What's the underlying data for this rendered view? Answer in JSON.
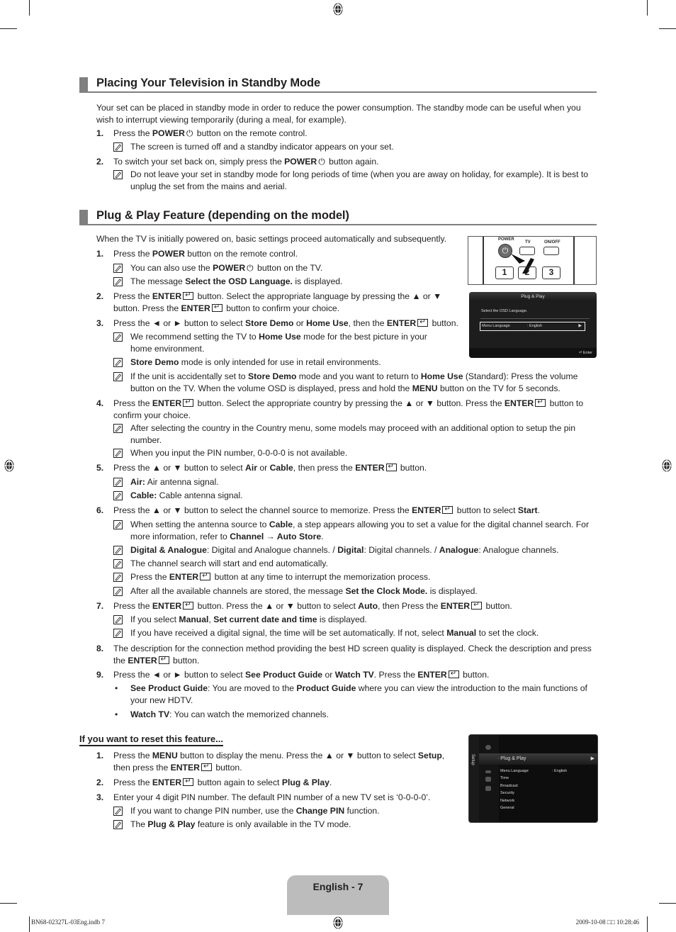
{
  "sections": {
    "standby": {
      "title": "Placing Your Television in Standby Mode",
      "intro": "Your set can be placed in standby mode in order to reduce the power consumption. The standby mode can be useful when you wish to interrupt viewing temporarily (during a meal, for example).",
      "steps": [
        {
          "num": "1.",
          "pre": "Press the ",
          "bold": "POWER",
          "post": " button on the remote control.",
          "notes": [
            "The screen is turned off and a standby indicator appears on your set."
          ]
        },
        {
          "num": "2.",
          "pre": "To switch your set back on, simply press the ",
          "bold": "POWER",
          "post": " button again.",
          "notes": [
            "Do not leave your set in standby mode for long periods of time (when you are away on holiday, for example). It is best to unplug the set from the mains and aerial."
          ]
        }
      ]
    },
    "plugplay": {
      "title": "Plug & Play Feature (depending on the model)",
      "intro": "When the TV is initially powered on, basic settings proceed automatically and subsequently.",
      "s1": {
        "num": "1.",
        "a": "Press the ",
        "b": "POWER",
        "c": " button on the remote control.",
        "n1a": "You can also use the ",
        "n1b": "POWER",
        "n1c": " button on the TV.",
        "n2a": "The message ",
        "n2b": "Select the OSD Language.",
        "n2c": " is displayed."
      },
      "s2": {
        "num": "2.",
        "a": "Press the ",
        "b": "ENTER",
        "c": " button. Select the appropriate language by pressing the ▲ or ▼ button. Press the ",
        "d": "ENTER",
        "e": " button to confirm your choice."
      },
      "s3": {
        "num": "3.",
        "a": "Press the ◄ or ► button to select ",
        "b": "Store Demo",
        "c": " or ",
        "d": "Home Use",
        "e": ", then the ",
        "f": "ENTER",
        "g": " button.",
        "n1a": "We recommend setting the TV to ",
        "n1b": "Home Use",
        "n1c": " mode for the best picture in your home environment.",
        "n2b": "Store Demo",
        "n2c": " mode is only intended for use in retail environments.",
        "n3a": "If the unit is accidentally set to ",
        "n3b": "Store Demo",
        "n3c": " mode and you want to return to ",
        "n3d": "Home Use",
        "n3e": " (Standard): Press the volume button on the TV. When the volume OSD is displayed, press and hold the ",
        "n3f": "MENU",
        "n3g": " button on the TV for 5 seconds."
      },
      "s4": {
        "num": "4.",
        "a": "Press the ",
        "b": "ENTER",
        "c": " button. Select the appropriate country by pressing the ▲ or ▼ button. Press the ",
        "d": "ENTER",
        "e": " button to confirm your choice.",
        "n1": "After selecting the country in the Country menu, some models may proceed with an additional option to setup the pin number.",
        "n2": "When you input the PIN number, 0-0-0-0 is not available."
      },
      "s5": {
        "num": "5.",
        "a": "Press the ▲ or ▼ button to select ",
        "b": "Air",
        "c": " or ",
        "d": "Cable",
        "e": ", then press the ",
        "f": "ENTER",
        "g": " button.",
        "n1b": "Air:",
        "n1c": " Air antenna signal.",
        "n2b": "Cable:",
        "n2c": " Cable antenna signal."
      },
      "s6": {
        "num": "6.",
        "a": "Press the ▲ or ▼ button to select the channel source to memorize. Press the ",
        "b": "ENTER",
        "c": " button to select ",
        "d": "Start",
        "e": ".",
        "n1a": "When setting the antenna source to ",
        "n1b": "Cable",
        "n1c": ", a step appears allowing you to set a value for the digital channel search. For more information, refer to ",
        "n1d": "Channel → Auto Store",
        "n1e": ".",
        "n2a": "Digital & Analogue",
        "n2b": ": Digital and Analogue channels. / ",
        "n2c": "Digital",
        "n2d": ": Digital channels. / ",
        "n2e": "Analogue",
        "n2f": ": Analogue channels.",
        "n3": "The channel search will start and end automatically.",
        "n4a": "Press the ",
        "n4b": "ENTER",
        "n4c": " button at any time to interrupt the memorization process.",
        "n5a": "After all the available channels are stored, the message ",
        "n5b": "Set the Clock Mode.",
        "n5c": " is displayed."
      },
      "s7": {
        "num": "7.",
        "a": "Press the ",
        "b": "ENTER",
        "c": " button. Press the ▲ or ▼ button to select ",
        "d": "Auto",
        "e": ", then Press the ",
        "f": "ENTER",
        "g": " button.",
        "n1a": "If you select ",
        "n1b": "Manual",
        "n1c": ", ",
        "n1d": "Set current date and time",
        "n1e": " is displayed.",
        "n2a": "If you have received a digital signal, the time will be set automatically. If not, select ",
        "n2b": "Manual",
        "n2c": " to set the clock."
      },
      "s8": {
        "num": "8.",
        "a": "The description for the connection method providing the best HD screen quality is displayed. Check the description and press the ",
        "b": "ENTER",
        "c": " button."
      },
      "s9": {
        "num": "9.",
        "a": "Press the ◄ or ► button to select ",
        "b": "See Product Guide",
        "c": " or ",
        "d": "Watch TV",
        "e": ". Press the ",
        "f": "ENTER",
        "g": " button.",
        "b1a": "See Product Guide",
        "b1b": ": You are moved to the ",
        "b1c": "Product Guide",
        "b1d": " where you can view the introduction to the main functions of your new HDTV.",
        "b2a": "Watch TV",
        "b2b": ": You can watch the memorized channels."
      }
    },
    "reset": {
      "title": "If you want to reset this feature...",
      "s1": {
        "num": "1.",
        "a": "Press the ",
        "b": "MENU",
        "c": " button to display the menu. Press the ▲ or ▼ button to select ",
        "d": "Setup",
        "e": ", then press the ",
        "f": "ENTER",
        "g": " button."
      },
      "s2": {
        "num": "2.",
        "a": "Press the ",
        "b": "ENTER",
        "c": " button again to select ",
        "d": "Plug & Play",
        "e": "."
      },
      "s3": {
        "num": "3.",
        "a": "Enter your 4 digit PIN number. The default PIN number of a new TV set is ‘0-0-0-0’.",
        "n1a": "If you want to change PIN number, use the ",
        "n1b": "Change PIN",
        "n1c": " function.",
        "n2a": "The ",
        "n2b": "Plug & Play",
        "n2c": " feature is only available in the TV mode."
      }
    }
  },
  "remote_image": {
    "power": "POWER",
    "tv": "TV",
    "onoff": "ON/OFF",
    "keys": [
      "1",
      "2",
      "3"
    ]
  },
  "osd_language": {
    "title": "Plug & Play",
    "message": "Select the OSD Language.",
    "row_label": "Menu Language",
    "row_value": ": English",
    "footer": "Enter"
  },
  "osd_setup": {
    "side_label": "Setup",
    "selected": "· Plug & Play",
    "items": [
      "Menu Language",
      "Time",
      "Broadcast",
      "Security",
      "Network",
      "General"
    ],
    "value": ": English"
  },
  "footer": {
    "page_label": "English - 7",
    "file": "BN68-02327L-03Eng.indb   7",
    "timestamp": "2009-10-08   □□ 10:28:46"
  }
}
